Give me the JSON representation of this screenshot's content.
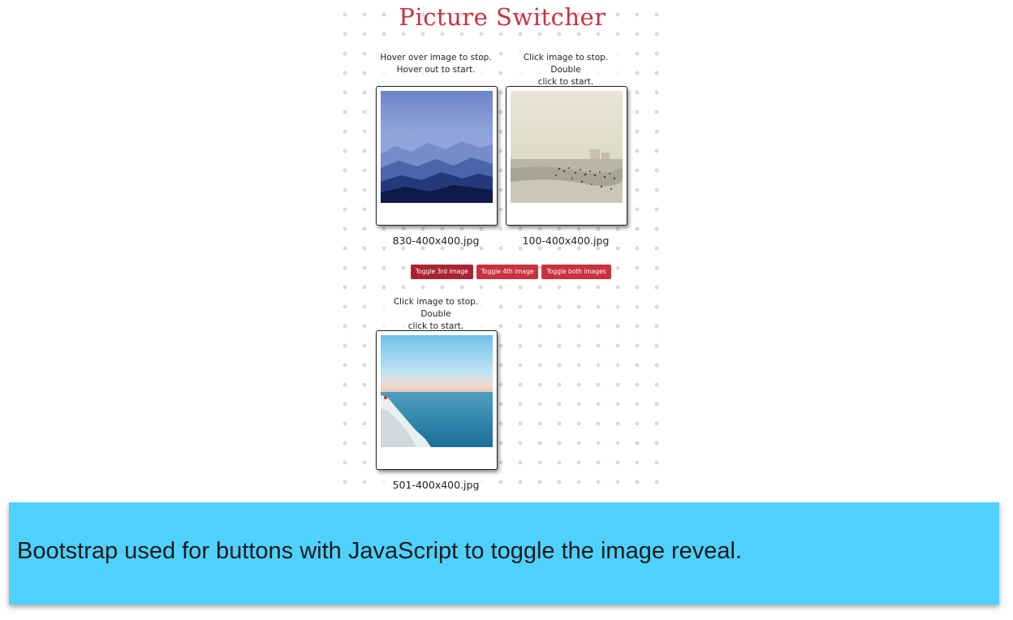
{
  "page": {
    "title": "Picture Switcher"
  },
  "cards": [
    {
      "caption_line1": "Hover over image to stop.",
      "caption_line2": "Hover out to start.",
      "filename": "830-400x400.jpg",
      "image": "misty-blue-mountains"
    },
    {
      "caption_line1": "Click image to stop. Double",
      "caption_line2": "click to start.",
      "filename": "100-400x400.jpg",
      "image": "hazy-beach-crowd"
    },
    {
      "caption_line1": "Click image to stop. Double",
      "caption_line2": "click to start.",
      "filename": "501-400x400.jpg",
      "image": "sea-cliff-horizon"
    }
  ],
  "buttons": {
    "toggle_3rd": "Toggle 3rd image",
    "toggle_4th": "Toggle 4th image",
    "toggle_both": "Toggle both images"
  },
  "banner": {
    "text": "Bootstrap used for buttons with JavaScript to toggle the image reveal."
  },
  "colors": {
    "accent": "#c9323f",
    "banner_bg": "#4fd1fd"
  }
}
